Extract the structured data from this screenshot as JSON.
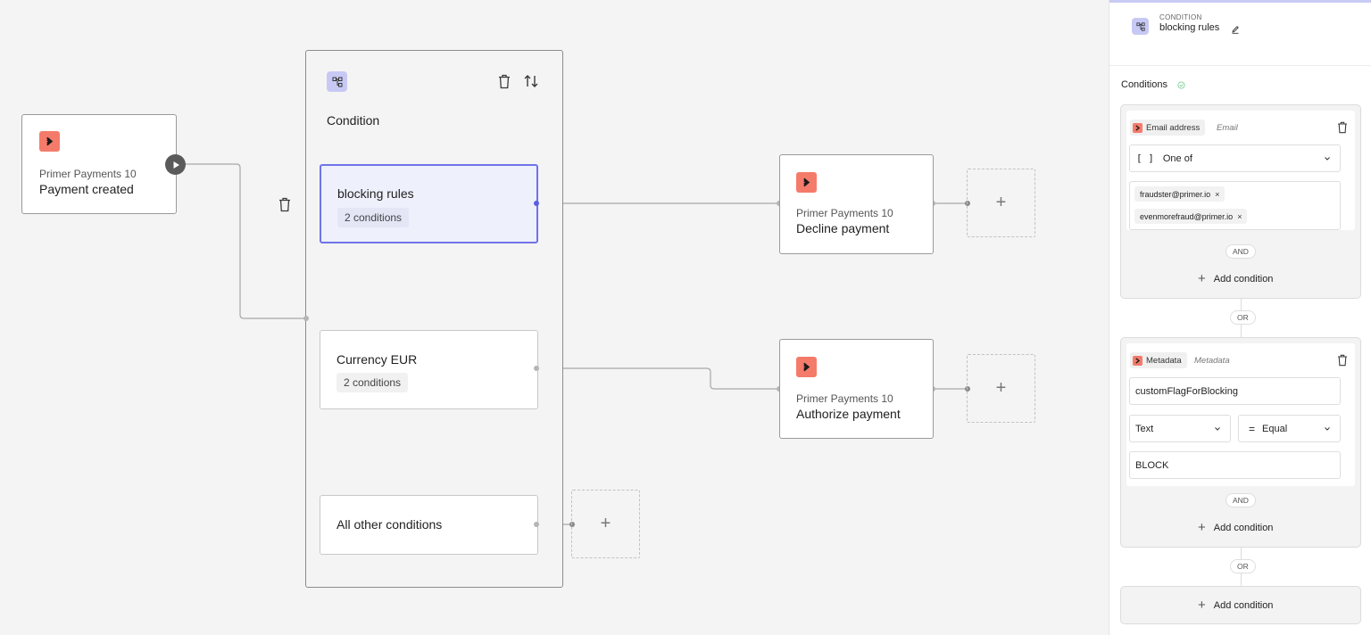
{
  "colors": {
    "app_badge": "#f47b6a",
    "condition_badge": "#c7c9f4",
    "selected_border": "#6f73e8",
    "selected_bg": "#eef0fc"
  },
  "trigger": {
    "icon": "primer-app-icon",
    "app": "Primer Payments 10",
    "action": "Payment created"
  },
  "condition_group": {
    "icon": "condition-icon",
    "title": "Condition",
    "branches": [
      {
        "name": "blocking rules",
        "count": "2 conditions"
      },
      {
        "name": "Currency EUR",
        "count": "2 conditions"
      },
      {
        "name": "All other conditions"
      }
    ]
  },
  "actions": [
    {
      "app": "Primer Payments 10",
      "action": "Decline payment"
    },
    {
      "app": "Primer Payments 10",
      "action": "Authorize payment"
    }
  ],
  "add_slot_glyph": "+",
  "panel": {
    "kicker": "CONDITION",
    "name": "blocking rules",
    "section": "Conditions",
    "groups": [
      {
        "attribute": "Email address",
        "attribute_type": "Email",
        "operator": "One of",
        "values": [
          "fraudster@primer.io",
          "evenmorefraud@primer.io"
        ],
        "and_label": "AND",
        "add_label": "Add condition"
      },
      {
        "attribute": "Metadata",
        "attribute_type": "Metadata",
        "key": "customFlagForBlocking",
        "value_type": "Text",
        "operator": "Equal",
        "value": "BLOCK",
        "and_label": "AND",
        "add_label": "Add condition"
      }
    ],
    "or_label": "OR",
    "add_group_label": "Add condition"
  }
}
